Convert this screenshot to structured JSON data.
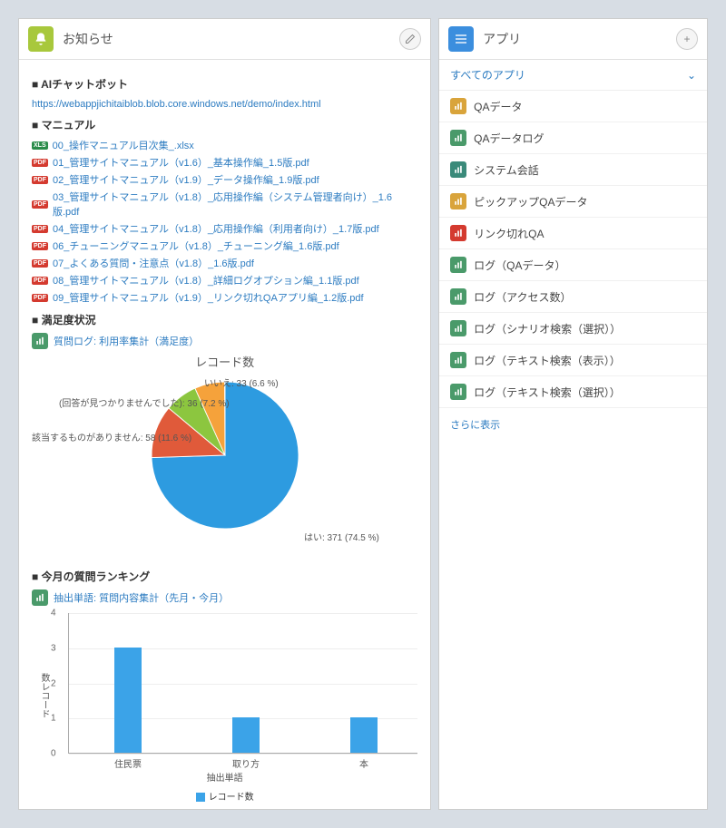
{
  "left": {
    "title": "お知らせ",
    "s1": {
      "h": "■ AIチャットボット",
      "url": "https://webappjichitaiblob.blob.core.windows.net/demo/index.html"
    },
    "s2": {
      "h": "■ マニュアル",
      "files": [
        {
          "type": "xls",
          "name": "00_操作マニュアル目次集_.xlsx"
        },
        {
          "type": "pdf",
          "name": "01_管理サイトマニュアル（v1.6）_基本操作編_1.5版.pdf"
        },
        {
          "type": "pdf",
          "name": "02_管理サイトマニュアル（v1.9）_データ操作編_1.9版.pdf"
        },
        {
          "type": "pdf",
          "name": "03_管理サイトマニュアル（v1.8）_応用操作編（システム管理者向け）_1.6版.pdf"
        },
        {
          "type": "pdf",
          "name": "04_管理サイトマニュアル（v1.8）_応用操作編（利用者向け）_1.7版.pdf"
        },
        {
          "type": "pdf",
          "name": "06_チューニングマニュアル（v1.8）_チューニング編_1.6版.pdf"
        },
        {
          "type": "pdf",
          "name": "07_よくある質問・注意点（v1.8）_1.6版.pdf"
        },
        {
          "type": "pdf",
          "name": "08_管理サイトマニュアル（v1.8）_詳細ログオプション編_1.1版.pdf"
        },
        {
          "type": "pdf",
          "name": "09_管理サイトマニュアル（v1.9）_リンク切れQAアプリ編_1.2版.pdf"
        }
      ]
    },
    "s3": {
      "h": "■ 満足度状況",
      "link": "質問ログ: 利用率集計（満足度）"
    },
    "s4": {
      "h": "■ 今月の質問ランキング",
      "link": "抽出単語: 質問内容集計（先月・今月）"
    }
  },
  "right": {
    "title": "アプリ",
    "all": "すべてのアプリ",
    "items": [
      {
        "label": "QAデータ",
        "color": "#d9a43b"
      },
      {
        "label": "QAデータログ",
        "color": "#4a9a6a"
      },
      {
        "label": "システム会話",
        "color": "#3a8a7a"
      },
      {
        "label": "ピックアップQAデータ",
        "color": "#d9a43b"
      },
      {
        "label": "リンク切れQA",
        "color": "#d43a2f"
      },
      {
        "label": "ログ（QAデータ）",
        "color": "#4a9a6a"
      },
      {
        "label": "ログ（アクセス数）",
        "color": "#4a9a6a"
      },
      {
        "label": "ログ（シナリオ検索（選択））",
        "color": "#4a9a6a"
      },
      {
        "label": "ログ（テキスト検索（表示））",
        "color": "#4a9a6a"
      },
      {
        "label": "ログ（テキスト検索（選択））",
        "color": "#4a9a6a"
      }
    ],
    "more": "さらに表示"
  },
  "chart_data": [
    {
      "type": "pie",
      "title": "レコード数",
      "series": [
        {
          "name": "はい",
          "value": 371,
          "pct": 74.5,
          "color": "#2d9be0"
        },
        {
          "name": "該当するものがありません",
          "value": 58,
          "pct": 11.6,
          "color": "#e05a3a"
        },
        {
          "name": "(回答が見つかりませんでした)",
          "value": 36,
          "pct": 7.2,
          "color": "#8cc63f"
        },
        {
          "name": "いいえ",
          "value": 33,
          "pct": 6.6,
          "color": "#f5a23b"
        }
      ],
      "labels": {
        "l0": "はい: 371 (74.5 %)",
        "l1": "該当するものがありません: 58 (11.6 %)",
        "l2": "(回答が見つかりませんでした): 36 (7.2 %)",
        "l3": "いいえ: 33 (6.6 %)"
      }
    },
    {
      "type": "bar",
      "title": "",
      "categories": [
        "住民票",
        "取り方",
        "本"
      ],
      "values": [
        3,
        1,
        1
      ],
      "xlabel": "抽出単語",
      "ylabel": "数レコード",
      "ylim": [
        0,
        4
      ],
      "legend": "レコード数",
      "yticks": {
        "t0": "0",
        "t1": "1",
        "t2": "2",
        "t3": "3",
        "t4": "4"
      }
    }
  ]
}
